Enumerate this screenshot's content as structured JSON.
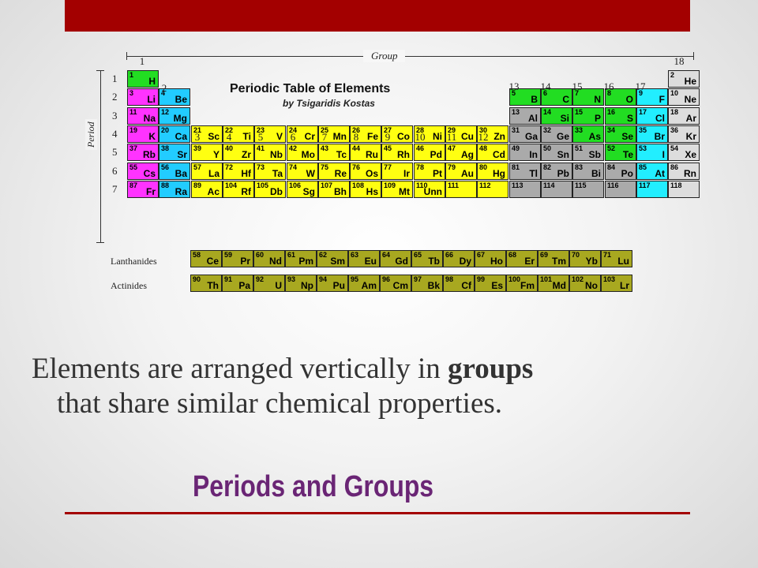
{
  "slide": {
    "title": "Periods and Groups",
    "body_part1": "Elements are arranged vertically in ",
    "body_bold": "groups",
    "body_part2": "that share similar chemical properties.",
    "accent_color": "#a30000",
    "title_color": "#6a2575"
  },
  "periodic_table": {
    "title": "Periodic Table of Elements",
    "subtitle": "by Tsigaridis Kostas",
    "group_axis_label": "Group",
    "period_axis_label": "Period",
    "group_numbers": [
      "1",
      "2",
      "3",
      "4",
      "5",
      "6",
      "7",
      "8",
      "9",
      "10",
      "11",
      "12",
      "13",
      "14",
      "15",
      "16",
      "17",
      "18"
    ],
    "period_numbers": [
      "1",
      "2",
      "3",
      "4",
      "5",
      "6",
      "7"
    ],
    "lanthanides_label": "Lanthanides",
    "actinides_label": "Actinides",
    "category_colors": {
      "nonmetal": "#22dd22",
      "alkali": "#ff33ff",
      "alkaline": "#22ccff",
      "transition": "#ffff11",
      "metalloid": "#22dd22",
      "poor": "#aaaaaa",
      "noble": "#dddddd",
      "halogen": "#22eeff",
      "unknown": "#ffff11",
      "f-block": "#a8a820"
    },
    "elements": [
      {
        "n": "1",
        "s": "H",
        "p": 1,
        "g": 1,
        "c": "nonmetal"
      },
      {
        "n": "2",
        "s": "He",
        "p": 1,
        "g": 18,
        "c": "noble"
      },
      {
        "n": "3",
        "s": "Li",
        "p": 2,
        "g": 1,
        "c": "alkali"
      },
      {
        "n": "4",
        "s": "Be",
        "p": 2,
        "g": 2,
        "c": "alkaline"
      },
      {
        "n": "5",
        "s": "B",
        "p": 2,
        "g": 13,
        "c": "metalloid"
      },
      {
        "n": "6",
        "s": "C",
        "p": 2,
        "g": 14,
        "c": "metalloid"
      },
      {
        "n": "7",
        "s": "N",
        "p": 2,
        "g": 15,
        "c": "metalloid"
      },
      {
        "n": "8",
        "s": "O",
        "p": 2,
        "g": 16,
        "c": "metalloid"
      },
      {
        "n": "9",
        "s": "F",
        "p": 2,
        "g": 17,
        "c": "halogen"
      },
      {
        "n": "10",
        "s": "Ne",
        "p": 2,
        "g": 18,
        "c": "noble"
      },
      {
        "n": "11",
        "s": "Na",
        "p": 3,
        "g": 1,
        "c": "alkali"
      },
      {
        "n": "12",
        "s": "Mg",
        "p": 3,
        "g": 2,
        "c": "alkaline"
      },
      {
        "n": "13",
        "s": "Al",
        "p": 3,
        "g": 13,
        "c": "poor"
      },
      {
        "n": "14",
        "s": "Si",
        "p": 3,
        "g": 14,
        "c": "metalloid"
      },
      {
        "n": "15",
        "s": "P",
        "p": 3,
        "g": 15,
        "c": "metalloid"
      },
      {
        "n": "16",
        "s": "S",
        "p": 3,
        "g": 16,
        "c": "metalloid"
      },
      {
        "n": "17",
        "s": "Cl",
        "p": 3,
        "g": 17,
        "c": "halogen"
      },
      {
        "n": "18",
        "s": "Ar",
        "p": 3,
        "g": 18,
        "c": "noble"
      },
      {
        "n": "19",
        "s": "K",
        "p": 4,
        "g": 1,
        "c": "alkali"
      },
      {
        "n": "20",
        "s": "Ca",
        "p": 4,
        "g": 2,
        "c": "alkaline"
      },
      {
        "n": "21",
        "s": "Sc",
        "p": 4,
        "g": 3,
        "c": "transition"
      },
      {
        "n": "22",
        "s": "Ti",
        "p": 4,
        "g": 4,
        "c": "transition"
      },
      {
        "n": "23",
        "s": "V",
        "p": 4,
        "g": 5,
        "c": "transition"
      },
      {
        "n": "24",
        "s": "Cr",
        "p": 4,
        "g": 6,
        "c": "transition"
      },
      {
        "n": "25",
        "s": "Mn",
        "p": 4,
        "g": 7,
        "c": "transition"
      },
      {
        "n": "26",
        "s": "Fe",
        "p": 4,
        "g": 8,
        "c": "transition"
      },
      {
        "n": "27",
        "s": "Co",
        "p": 4,
        "g": 9,
        "c": "transition"
      },
      {
        "n": "28",
        "s": "Ni",
        "p": 4,
        "g": 10,
        "c": "transition"
      },
      {
        "n": "29",
        "s": "Cu",
        "p": 4,
        "g": 11,
        "c": "transition"
      },
      {
        "n": "30",
        "s": "Zn",
        "p": 4,
        "g": 12,
        "c": "transition"
      },
      {
        "n": "31",
        "s": "Ga",
        "p": 4,
        "g": 13,
        "c": "poor"
      },
      {
        "n": "32",
        "s": "Ge",
        "p": 4,
        "g": 14,
        "c": "poor"
      },
      {
        "n": "33",
        "s": "As",
        "p": 4,
        "g": 15,
        "c": "metalloid"
      },
      {
        "n": "34",
        "s": "Se",
        "p": 4,
        "g": 16,
        "c": "metalloid"
      },
      {
        "n": "35",
        "s": "Br",
        "p": 4,
        "g": 17,
        "c": "halogen"
      },
      {
        "n": "36",
        "s": "Kr",
        "p": 4,
        "g": 18,
        "c": "noble"
      },
      {
        "n": "37",
        "s": "Rb",
        "p": 5,
        "g": 1,
        "c": "alkali"
      },
      {
        "n": "38",
        "s": "Sr",
        "p": 5,
        "g": 2,
        "c": "alkaline"
      },
      {
        "n": "39",
        "s": "Y",
        "p": 5,
        "g": 3,
        "c": "transition"
      },
      {
        "n": "40",
        "s": "Zr",
        "p": 5,
        "g": 4,
        "c": "transition"
      },
      {
        "n": "41",
        "s": "Nb",
        "p": 5,
        "g": 5,
        "c": "transition"
      },
      {
        "n": "42",
        "s": "Mo",
        "p": 5,
        "g": 6,
        "c": "transition"
      },
      {
        "n": "43",
        "s": "Tc",
        "p": 5,
        "g": 7,
        "c": "transition"
      },
      {
        "n": "44",
        "s": "Ru",
        "p": 5,
        "g": 8,
        "c": "transition"
      },
      {
        "n": "45",
        "s": "Rh",
        "p": 5,
        "g": 9,
        "c": "transition"
      },
      {
        "n": "46",
        "s": "Pd",
        "p": 5,
        "g": 10,
        "c": "transition"
      },
      {
        "n": "47",
        "s": "Ag",
        "p": 5,
        "g": 11,
        "c": "transition"
      },
      {
        "n": "48",
        "s": "Cd",
        "p": 5,
        "g": 12,
        "c": "transition"
      },
      {
        "n": "49",
        "s": "In",
        "p": 5,
        "g": 13,
        "c": "poor"
      },
      {
        "n": "50",
        "s": "Sn",
        "p": 5,
        "g": 14,
        "c": "poor"
      },
      {
        "n": "51",
        "s": "Sb",
        "p": 5,
        "g": 15,
        "c": "poor"
      },
      {
        "n": "52",
        "s": "Te",
        "p": 5,
        "g": 16,
        "c": "metalloid"
      },
      {
        "n": "53",
        "s": "I",
        "p": 5,
        "g": 17,
        "c": "halogen"
      },
      {
        "n": "54",
        "s": "Xe",
        "p": 5,
        "g": 18,
        "c": "noble"
      },
      {
        "n": "55",
        "s": "Cs",
        "p": 6,
        "g": 1,
        "c": "alkali"
      },
      {
        "n": "56",
        "s": "Ba",
        "p": 6,
        "g": 2,
        "c": "alkaline"
      },
      {
        "n": "57",
        "s": "La",
        "p": 6,
        "g": 3,
        "c": "transition"
      },
      {
        "n": "72",
        "s": "Hf",
        "p": 6,
        "g": 4,
        "c": "transition"
      },
      {
        "n": "73",
        "s": "Ta",
        "p": 6,
        "g": 5,
        "c": "transition"
      },
      {
        "n": "74",
        "s": "W",
        "p": 6,
        "g": 6,
        "c": "transition"
      },
      {
        "n": "75",
        "s": "Re",
        "p": 6,
        "g": 7,
        "c": "transition"
      },
      {
        "n": "76",
        "s": "Os",
        "p": 6,
        "g": 8,
        "c": "transition"
      },
      {
        "n": "77",
        "s": "Ir",
        "p": 6,
        "g": 9,
        "c": "transition"
      },
      {
        "n": "78",
        "s": "Pt",
        "p": 6,
        "g": 10,
        "c": "transition"
      },
      {
        "n": "79",
        "s": "Au",
        "p": 6,
        "g": 11,
        "c": "transition"
      },
      {
        "n": "80",
        "s": "Hg",
        "p": 6,
        "g": 12,
        "c": "transition"
      },
      {
        "n": "81",
        "s": "Tl",
        "p": 6,
        "g": 13,
        "c": "poor"
      },
      {
        "n": "82",
        "s": "Pb",
        "p": 6,
        "g": 14,
        "c": "poor"
      },
      {
        "n": "83",
        "s": "Bi",
        "p": 6,
        "g": 15,
        "c": "poor"
      },
      {
        "n": "84",
        "s": "Po",
        "p": 6,
        "g": 16,
        "c": "poor"
      },
      {
        "n": "85",
        "s": "At",
        "p": 6,
        "g": 17,
        "c": "halogen"
      },
      {
        "n": "86",
        "s": "Rn",
        "p": 6,
        "g": 18,
        "c": "noble"
      },
      {
        "n": "87",
        "s": "Fr",
        "p": 7,
        "g": 1,
        "c": "alkali"
      },
      {
        "n": "88",
        "s": "Ra",
        "p": 7,
        "g": 2,
        "c": "alkaline"
      },
      {
        "n": "89",
        "s": "Ac",
        "p": 7,
        "g": 3,
        "c": "transition"
      },
      {
        "n": "104",
        "s": "Rf",
        "p": 7,
        "g": 4,
        "c": "transition"
      },
      {
        "n": "105",
        "s": "Db",
        "p": 7,
        "g": 5,
        "c": "transition"
      },
      {
        "n": "106",
        "s": "Sg",
        "p": 7,
        "g": 6,
        "c": "transition"
      },
      {
        "n": "107",
        "s": "Bh",
        "p": 7,
        "g": 7,
        "c": "transition"
      },
      {
        "n": "108",
        "s": "Hs",
        "p": 7,
        "g": 8,
        "c": "transition"
      },
      {
        "n": "109",
        "s": "Mt",
        "p": 7,
        "g": 9,
        "c": "transition"
      },
      {
        "n": "110",
        "s": "Unn",
        "p": 7,
        "g": 10,
        "c": "transition"
      },
      {
        "n": "111",
        "s": "",
        "p": 7,
        "g": 11,
        "c": "unknown"
      },
      {
        "n": "112",
        "s": "",
        "p": 7,
        "g": 12,
        "c": "unknown"
      },
      {
        "n": "113",
        "s": "",
        "p": 7,
        "g": 13,
        "c": "poor"
      },
      {
        "n": "114",
        "s": "",
        "p": 7,
        "g": 14,
        "c": "poor"
      },
      {
        "n": "115",
        "s": "",
        "p": 7,
        "g": 15,
        "c": "poor"
      },
      {
        "n": "116",
        "s": "",
        "p": 7,
        "g": 16,
        "c": "poor"
      },
      {
        "n": "117",
        "s": "",
        "p": 7,
        "g": 17,
        "c": "halogen"
      },
      {
        "n": "118",
        "s": "",
        "p": 7,
        "g": 18,
        "c": "noble"
      }
    ],
    "lanthanides": [
      {
        "n": "58",
        "s": "Ce"
      },
      {
        "n": "59",
        "s": "Pr"
      },
      {
        "n": "60",
        "s": "Nd"
      },
      {
        "n": "61",
        "s": "Pm"
      },
      {
        "n": "62",
        "s": "Sm"
      },
      {
        "n": "63",
        "s": "Eu"
      },
      {
        "n": "64",
        "s": "Gd"
      },
      {
        "n": "65",
        "s": "Tb"
      },
      {
        "n": "66",
        "s": "Dy"
      },
      {
        "n": "67",
        "s": "Ho"
      },
      {
        "n": "68",
        "s": "Er"
      },
      {
        "n": "69",
        "s": "Tm"
      },
      {
        "n": "70",
        "s": "Yb"
      },
      {
        "n": "71",
        "s": "Lu"
      }
    ],
    "actinides": [
      {
        "n": "90",
        "s": "Th"
      },
      {
        "n": "91",
        "s": "Pa"
      },
      {
        "n": "92",
        "s": "U"
      },
      {
        "n": "93",
        "s": "Np"
      },
      {
        "n": "94",
        "s": "Pu"
      },
      {
        "n": "95",
        "s": "Am"
      },
      {
        "n": "96",
        "s": "Cm"
      },
      {
        "n": "97",
        "s": "Bk"
      },
      {
        "n": "98",
        "s": "Cf"
      },
      {
        "n": "99",
        "s": "Es"
      },
      {
        "n": "100",
        "s": "Fm"
      },
      {
        "n": "101",
        "s": "Md"
      },
      {
        "n": "102",
        "s": "No"
      },
      {
        "n": "103",
        "s": "Lr"
      }
    ]
  }
}
